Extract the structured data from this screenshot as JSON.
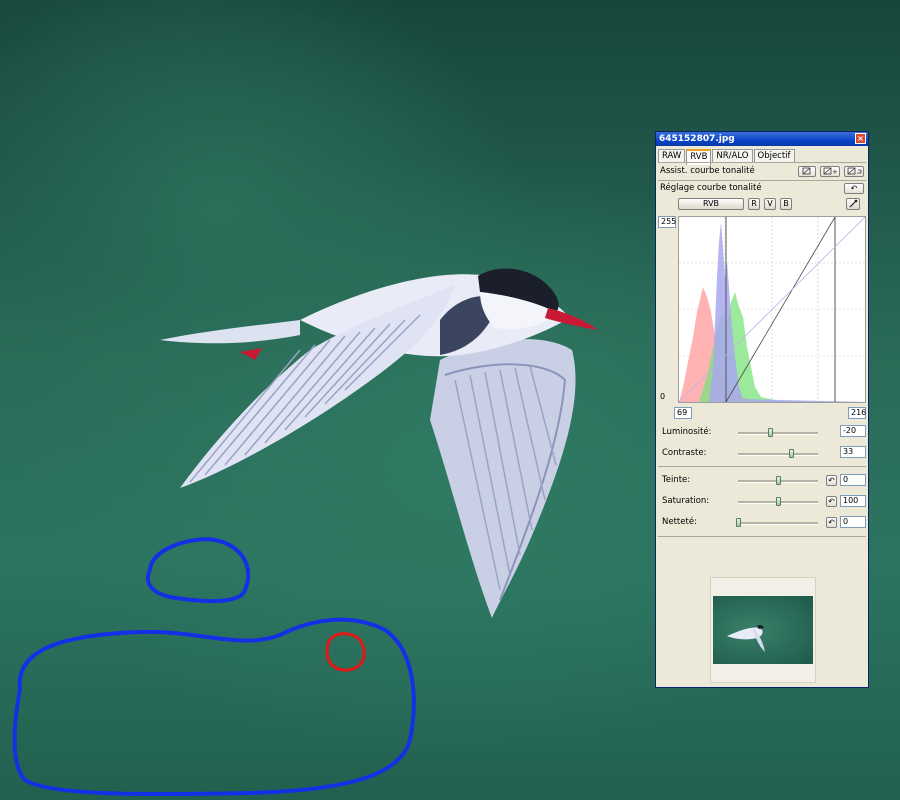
{
  "window": {
    "title": "645152807.jpg",
    "close_glyph": "×"
  },
  "tabs": [
    {
      "label": "RAW",
      "active": false
    },
    {
      "label": "RVB",
      "active": true
    },
    {
      "label": "NR/ALO",
      "active": false
    },
    {
      "label": "Objectif",
      "active": false
    }
  ],
  "tone_assist": {
    "label": "Assist. courbe tonalité"
  },
  "tone_adjust": {
    "label": "Réglage courbe tonalité",
    "reset_glyph": "↶"
  },
  "channels": {
    "all": "RVB",
    "r": "R",
    "v": "V",
    "b": "B",
    "eyedropper_icon": "eyedropper-icon"
  },
  "curve": {
    "y_max_label": "255",
    "y_min_label": "0",
    "input_low": "69",
    "input_high": "216",
    "histogram_colors": {
      "red": "#ff9a9a",
      "green": "#7be37b",
      "blue": "#a8a8f0"
    }
  },
  "adjustments": {
    "luminosity": {
      "label": "Luminosité:",
      "value": "-20",
      "level": 0.4
    },
    "contrast": {
      "label": "Contraste:",
      "value": "33",
      "level": 0.66
    },
    "hue": {
      "label": "Teinte:",
      "value": "0",
      "level": 0.5
    },
    "saturation": {
      "label": "Saturation:",
      "value": "100",
      "level": 0.5
    },
    "sharpness": {
      "label": "Netteté:",
      "value": "0",
      "level": 0.0
    }
  },
  "annotations": {
    "stroke_blue": "#1430e6",
    "stroke_red": "#e01818"
  }
}
